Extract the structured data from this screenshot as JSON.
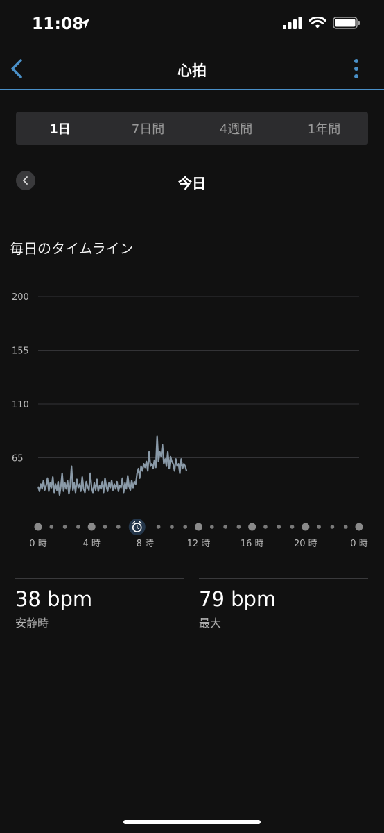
{
  "status_bar": {
    "time": "11:08"
  },
  "nav": {
    "title": "心拍"
  },
  "tabs": [
    {
      "label": "1日",
      "active": true
    },
    {
      "label": "7日間",
      "active": false
    },
    {
      "label": "4週間",
      "active": false
    },
    {
      "label": "1年間",
      "active": false
    }
  ],
  "date": {
    "label": "今日"
  },
  "section": {
    "title": "毎日のタイムライン"
  },
  "colors": {
    "accent": "#4a90c8",
    "line": "#8a9aa8",
    "background": "#111111"
  },
  "chart_data": {
    "type": "line",
    "ylim": [
      20,
      200
    ],
    "xlim": [
      0,
      24
    ],
    "y_ticks": [
      "200",
      "155",
      "110",
      "65"
    ],
    "y_tick_values": [
      200,
      155,
      110,
      65
    ],
    "x_tick_labels": [
      "0 時",
      "4 時",
      "8 時",
      "12 時",
      "16 時",
      "20 時",
      "0 時"
    ],
    "x_tick_values": [
      0,
      4,
      8,
      12,
      16,
      20,
      24
    ],
    "alarm_marker_hour": 7.4,
    "series": [
      {
        "x": [
          0.0,
          0.1,
          0.2,
          0.3,
          0.4,
          0.5,
          0.6,
          0.7,
          0.8,
          0.9,
          1.0,
          1.1,
          1.2,
          1.3,
          1.4,
          1.5,
          1.6,
          1.7,
          1.8,
          1.9,
          2.0,
          2.1,
          2.2,
          2.3,
          2.4,
          2.5,
          2.6,
          2.7,
          2.8,
          2.9,
          3.0,
          3.1,
          3.2,
          3.3,
          3.4,
          3.5,
          3.6,
          3.7,
          3.8,
          3.9,
          4.0,
          4.1,
          4.2,
          4.3,
          4.4,
          4.5,
          4.6,
          4.7,
          4.8,
          4.9,
          5.0,
          5.1,
          5.2,
          5.3,
          5.4,
          5.5,
          5.6,
          5.7,
          5.8,
          5.9,
          6.0,
          6.1,
          6.2,
          6.3,
          6.4,
          6.5,
          6.6,
          6.7,
          6.8,
          6.9,
          7.0,
          7.1,
          7.2,
          7.3,
          7.4,
          7.5,
          7.6,
          7.7,
          7.8,
          7.9,
          8.0,
          8.1,
          8.2,
          8.3,
          8.4,
          8.5,
          8.6,
          8.7,
          8.8,
          8.9,
          9.0,
          9.1,
          9.2,
          9.3,
          9.4,
          9.5,
          9.6,
          9.7,
          9.8,
          9.9,
          10.0,
          10.1,
          10.2,
          10.3,
          10.4,
          10.5,
          10.6,
          10.7,
          10.8,
          10.9,
          11.0,
          11.1
        ],
        "y": [
          41,
          37,
          43,
          39,
          46,
          38,
          42,
          48,
          37,
          44,
          40,
          49,
          36,
          43,
          38,
          45,
          34,
          41,
          52,
          37,
          44,
          39,
          46,
          35,
          42,
          58,
          38,
          44,
          36,
          47,
          40,
          43,
          37,
          49,
          39,
          36,
          45,
          41,
          38,
          52,
          40,
          36,
          44,
          38,
          47,
          37,
          42,
          39,
          45,
          36,
          48,
          41,
          37,
          44,
          40,
          46,
          38,
          43,
          39,
          45,
          37,
          42,
          40,
          48,
          36,
          44,
          39,
          50,
          41,
          38,
          46,
          40,
          45,
          43,
          52,
          56,
          48,
          58,
          54,
          60,
          57,
          62,
          54,
          70,
          58,
          60,
          56,
          63,
          57,
          83,
          62,
          70,
          66,
          76,
          60,
          64,
          58,
          70,
          56,
          66,
          62,
          60,
          54,
          64,
          58,
          60,
          52,
          64,
          56,
          60,
          58,
          54
        ]
      }
    ]
  },
  "stats": [
    {
      "value": "38 bpm",
      "label": "安静時"
    },
    {
      "value": "79 bpm",
      "label": "最大"
    }
  ]
}
